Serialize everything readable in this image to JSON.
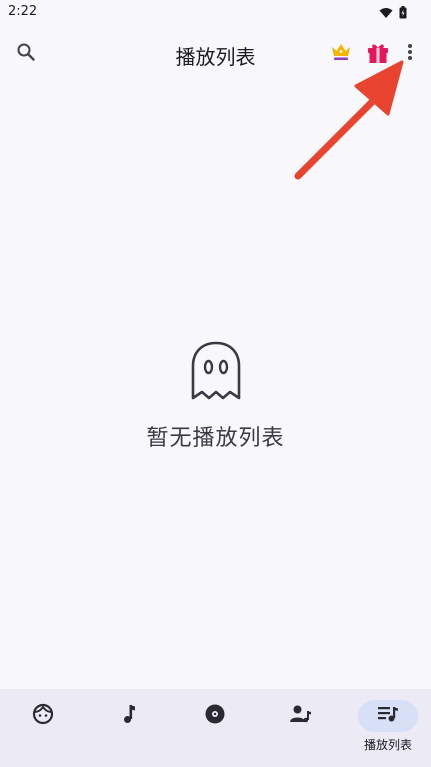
{
  "status_bar": {
    "time": "2:22",
    "icons": [
      "wifi-icon",
      "battery-icon"
    ]
  },
  "app_bar": {
    "title": "播放列表",
    "actions": [
      "search-icon",
      "crown-icon",
      "gift-icon",
      "more-vert-icon"
    ]
  },
  "empty_state": {
    "icon": "ghost-icon",
    "message": "暂无播放列表"
  },
  "bottom_nav": {
    "items": [
      {
        "icon": "face-icon",
        "label": ""
      },
      {
        "icon": "music-note-icon",
        "label": ""
      },
      {
        "icon": "album-icon",
        "label": ""
      },
      {
        "icon": "artist-icon",
        "label": ""
      },
      {
        "icon": "playlist-icon",
        "label": "播放列表",
        "active": true
      }
    ]
  },
  "colors": {
    "background": "#f8f7fc",
    "nav_background": "#ecebf5",
    "nav_active_pill": "#d8e0f8",
    "annotation_arrow": "#e8442f",
    "crown": "#f5b400",
    "gift": "#e5195a"
  }
}
